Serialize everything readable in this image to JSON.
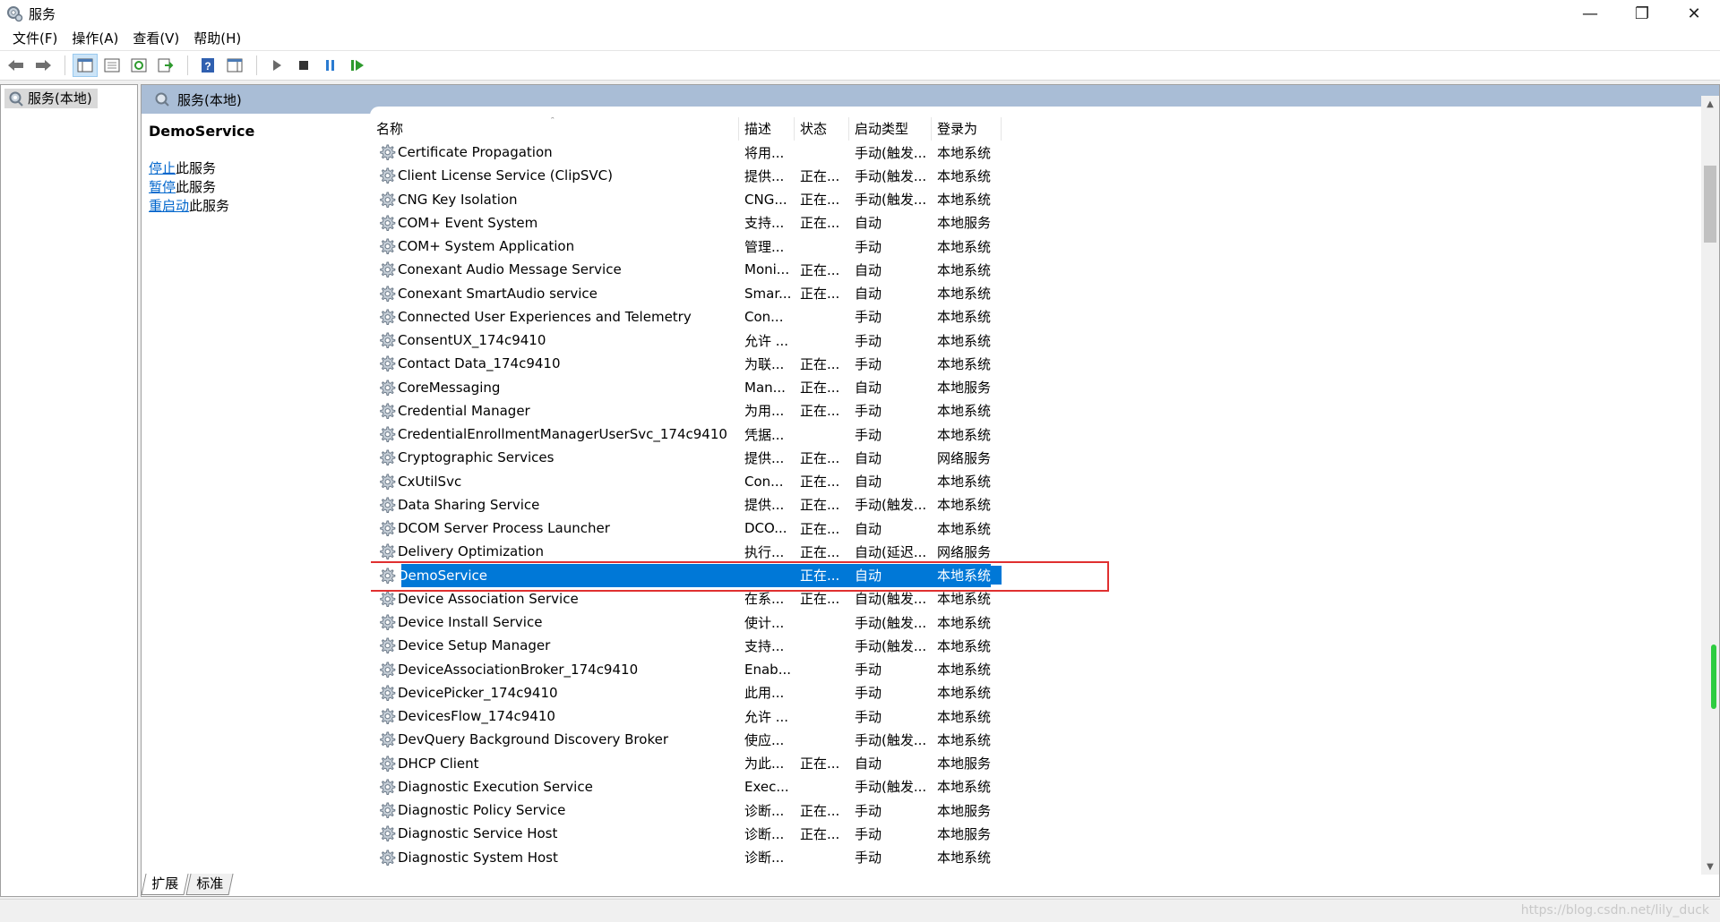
{
  "window": {
    "title": "服务",
    "minimize": "—",
    "maximize": "❐",
    "close": "✕"
  },
  "menu": [
    "文件(F)",
    "操作(A)",
    "查看(V)",
    "帮助(H)"
  ],
  "toolbar": {
    "icons": [
      "back-icon",
      "forward-icon",
      "show-hide-console-tree-icon",
      "properties-icon",
      "refresh-icon",
      "export-list-icon",
      "help-icon",
      "show-action-pane-icon",
      "start-service-icon",
      "stop-service-icon",
      "pause-service-icon",
      "restart-service-icon"
    ]
  },
  "tree": {
    "root_label": "服务(本地)"
  },
  "pane": {
    "header_label": "服务(本地)"
  },
  "details": {
    "service_name": "DemoService",
    "stop_link": "停止",
    "stop_suffix": "此服务",
    "pause_link": "暂停",
    "pause_suffix": "此服务",
    "restart_link": "重启动",
    "restart_suffix": "此服务"
  },
  "columns": {
    "name": "名称",
    "desc": "描述",
    "status": "状态",
    "startup": "启动类型",
    "logon": "登录为"
  },
  "services": [
    {
      "name": "Certificate Propagation",
      "desc": "将用...",
      "status": "",
      "startup": "手动(触发...",
      "logon": "本地系统"
    },
    {
      "name": "Client License Service (ClipSVC)",
      "desc": "提供...",
      "status": "正在...",
      "startup": "手动(触发...",
      "logon": "本地系统"
    },
    {
      "name": "CNG Key Isolation",
      "desc": "CNG...",
      "status": "正在...",
      "startup": "手动(触发...",
      "logon": "本地系统"
    },
    {
      "name": "COM+ Event System",
      "desc": "支持...",
      "status": "正在...",
      "startup": "自动",
      "logon": "本地服务"
    },
    {
      "name": "COM+ System Application",
      "desc": "管理...",
      "status": "",
      "startup": "手动",
      "logon": "本地系统"
    },
    {
      "name": "Conexant Audio Message Service",
      "desc": "Moni...",
      "status": "正在...",
      "startup": "自动",
      "logon": "本地系统"
    },
    {
      "name": "Conexant SmartAudio service",
      "desc": "Smar...",
      "status": "正在...",
      "startup": "自动",
      "logon": "本地系统"
    },
    {
      "name": "Connected User Experiences and Telemetry",
      "desc": "Con...",
      "status": "",
      "startup": "手动",
      "logon": "本地系统"
    },
    {
      "name": "ConsentUX_174c9410",
      "desc": "允许 ...",
      "status": "",
      "startup": "手动",
      "logon": "本地系统"
    },
    {
      "name": "Contact Data_174c9410",
      "desc": "为联...",
      "status": "正在...",
      "startup": "手动",
      "logon": "本地系统"
    },
    {
      "name": "CoreMessaging",
      "desc": "Man...",
      "status": "正在...",
      "startup": "自动",
      "logon": "本地服务"
    },
    {
      "name": "Credential Manager",
      "desc": "为用...",
      "status": "正在...",
      "startup": "手动",
      "logon": "本地系统"
    },
    {
      "name": "CredentialEnrollmentManagerUserSvc_174c9410",
      "desc": "凭据...",
      "status": "",
      "startup": "手动",
      "logon": "本地系统"
    },
    {
      "name": "Cryptographic Services",
      "desc": "提供...",
      "status": "正在...",
      "startup": "自动",
      "logon": "网络服务"
    },
    {
      "name": "CxUtilSvc",
      "desc": "Con...",
      "status": "正在...",
      "startup": "自动",
      "logon": "本地系统"
    },
    {
      "name": "Data Sharing Service",
      "desc": "提供...",
      "status": "正在...",
      "startup": "手动(触发...",
      "logon": "本地系统"
    },
    {
      "name": "DCOM Server Process Launcher",
      "desc": "DCO...",
      "status": "正在...",
      "startup": "自动",
      "logon": "本地系统"
    },
    {
      "name": "Delivery Optimization",
      "desc": "执行...",
      "status": "正在...",
      "startup": "自动(延迟...",
      "logon": "网络服务"
    },
    {
      "name": "DemoService",
      "desc": "",
      "status": "正在...",
      "startup": "自动",
      "logon": "本地系统",
      "selected": true
    },
    {
      "name": "Device Association Service",
      "desc": "在系...",
      "status": "正在...",
      "startup": "自动(触发...",
      "logon": "本地系统"
    },
    {
      "name": "Device Install Service",
      "desc": "使计...",
      "status": "",
      "startup": "手动(触发...",
      "logon": "本地系统"
    },
    {
      "name": "Device Setup Manager",
      "desc": "支持...",
      "status": "",
      "startup": "手动(触发...",
      "logon": "本地系统"
    },
    {
      "name": "DeviceAssociationBroker_174c9410",
      "desc": "Enab...",
      "status": "",
      "startup": "手动",
      "logon": "本地系统"
    },
    {
      "name": "DevicePicker_174c9410",
      "desc": "此用...",
      "status": "",
      "startup": "手动",
      "logon": "本地系统"
    },
    {
      "name": "DevicesFlow_174c9410",
      "desc": "允许 ...",
      "status": "",
      "startup": "手动",
      "logon": "本地系统"
    },
    {
      "name": "DevQuery Background Discovery Broker",
      "desc": "使应...",
      "status": "",
      "startup": "手动(触发...",
      "logon": "本地系统"
    },
    {
      "name": "DHCP Client",
      "desc": "为此...",
      "status": "正在...",
      "startup": "自动",
      "logon": "本地服务"
    },
    {
      "name": "Diagnostic Execution Service",
      "desc": "Exec...",
      "status": "",
      "startup": "手动(触发...",
      "logon": "本地系统"
    },
    {
      "name": "Diagnostic Policy Service",
      "desc": "诊断...",
      "status": "正在...",
      "startup": "手动",
      "logon": "本地服务"
    },
    {
      "name": "Diagnostic Service Host",
      "desc": "诊断...",
      "status": "正在...",
      "startup": "手动",
      "logon": "本地服务"
    },
    {
      "name": "Diagnostic System Host",
      "desc": "诊断...",
      "status": "",
      "startup": "手动",
      "logon": "本地系统"
    }
  ],
  "bottom_tabs": [
    "扩展",
    "标准"
  ],
  "watermark": "https://blog.csdn.net/lily_duck",
  "colors": {
    "selection": "#0078d7",
    "highlight_box": "#e03030",
    "pane_header": "#a9bdd6",
    "link": "#0066cc"
  }
}
